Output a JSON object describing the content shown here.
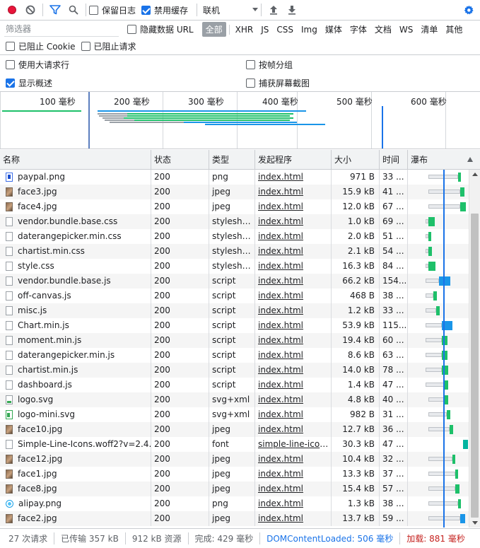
{
  "toolbar": {
    "preserve_log": "保留日志",
    "disable_cache": "禁用缓存",
    "throttle": "联机"
  },
  "filter": {
    "placeholder": "筛选器",
    "hide_data_urls": "隐藏数据 URL",
    "types": [
      "全部",
      "XHR",
      "JS",
      "CSS",
      "Img",
      "媒体",
      "字体",
      "文档",
      "WS",
      "清单",
      "其他"
    ],
    "blocked_cookies": "已阻止 Cookie",
    "blocked_requests": "已阻止请求"
  },
  "settings": {
    "large_rows": "使用大请求行",
    "group_by_frame": "按帧分组",
    "show_overview": "显示概述",
    "capture_screenshots": "捕获屏幕截图"
  },
  "overview": {
    "ticks": [
      "100 毫秒",
      "200 毫秒",
      "300 毫秒",
      "400 毫秒",
      "500 毫秒",
      "600 毫秒"
    ]
  },
  "columns": {
    "name": "名称",
    "status": "状态",
    "type": "类型",
    "initiator": "发起程序",
    "size": "大小",
    "time": "时间",
    "waterfall": "瀑布"
  },
  "requests": [
    {
      "name": "paypal.png",
      "status": "200",
      "type": "png",
      "initiator": "index.html",
      "size": "971 B",
      "time": "33 ...",
      "icon": "blue",
      "wf": {
        "start": 0.1,
        "wait": 0.22,
        "dl": 0.04
      },
      "dl_color": "#1ec06a"
    },
    {
      "name": "face3.jpg",
      "status": "200",
      "type": "jpeg",
      "initiator": "index.html",
      "size": "15.9 kB",
      "time": "41 ...",
      "icon": "img",
      "wf": {
        "start": 0.1,
        "wait": 0.24,
        "dl": 0.05
      },
      "dl_color": "#1ec06a"
    },
    {
      "name": "face4.jpg",
      "status": "200",
      "type": "jpeg",
      "initiator": "index.html",
      "size": "12.0 kB",
      "time": "67 ...",
      "icon": "img",
      "wf": {
        "start": 0.1,
        "wait": 0.24,
        "dl": 0.07
      },
      "dl_color": "#1ec06a"
    },
    {
      "name": "vendor.bundle.base.css",
      "status": "200",
      "type": "stylesheet",
      "initiator": "index.html",
      "size": "1.0 kB",
      "time": "69 ...",
      "icon": "file",
      "wf": {
        "start": 0.08,
        "wait": 0.02,
        "dl": 0.08
      },
      "dl_color": "#1ec06a"
    },
    {
      "name": "daterangepicker.min.css",
      "status": "200",
      "type": "stylesheet",
      "initiator": "index.html",
      "size": "2.0 kB",
      "time": "51 ...",
      "icon": "file",
      "wf": {
        "start": 0.08,
        "wait": 0.02,
        "dl": 0.04
      },
      "dl_color": "#1ec06a"
    },
    {
      "name": "chartist.min.css",
      "status": "200",
      "type": "stylesheet",
      "initiator": "index.html",
      "size": "2.1 kB",
      "time": "54 ...",
      "icon": "file",
      "wf": {
        "start": 0.08,
        "wait": 0.02,
        "dl": 0.05
      },
      "dl_color": "#1ec06a"
    },
    {
      "name": "style.css",
      "status": "200",
      "type": "stylesheet",
      "initiator": "index.html",
      "size": "16.3 kB",
      "time": "84 ...",
      "icon": "file",
      "wf": {
        "start": 0.08,
        "wait": 0.02,
        "dl": 0.09
      },
      "dl_color": "#1ec06a"
    },
    {
      "name": "vendor.bundle.base.js",
      "status": "200",
      "type": "script",
      "initiator": "index.html",
      "size": "66.2 kB",
      "time": "154...",
      "icon": "file",
      "wf": {
        "start": 0.08,
        "wait": 0.1,
        "dl": 0.14
      },
      "dl_color": "#1a95e8"
    },
    {
      "name": "off-canvas.js",
      "status": "200",
      "type": "script",
      "initiator": "index.html",
      "size": "468 B",
      "time": "38 ...",
      "icon": "file",
      "wf": {
        "start": 0.08,
        "wait": 0.06,
        "dl": 0.04
      },
      "dl_color": "#1ec06a"
    },
    {
      "name": "misc.js",
      "status": "200",
      "type": "script",
      "initiator": "index.html",
      "size": "1.2 kB",
      "time": "33 ...",
      "icon": "file",
      "wf": {
        "start": 0.08,
        "wait": 0.08,
        "dl": 0.04
      },
      "dl_color": "#1ec06a"
    },
    {
      "name": "Chart.min.js",
      "status": "200",
      "type": "script",
      "initiator": "index.html",
      "size": "53.9 kB",
      "time": "115...",
      "icon": "file",
      "wf": {
        "start": 0.08,
        "wait": 0.12,
        "dl": 0.14
      },
      "dl_color": "#1a95e8"
    },
    {
      "name": "moment.min.js",
      "status": "200",
      "type": "script",
      "initiator": "index.html",
      "size": "19.4 kB",
      "time": "60 ...",
      "icon": "file",
      "wf": {
        "start": 0.08,
        "wait": 0.12,
        "dl": 0.07
      },
      "dl_color": "#1ec06a"
    },
    {
      "name": "daterangepicker.min.js",
      "status": "200",
      "type": "script",
      "initiator": "index.html",
      "size": "8.6 kB",
      "time": "63 ...",
      "icon": "file",
      "wf": {
        "start": 0.08,
        "wait": 0.12,
        "dl": 0.07
      },
      "dl_color": "#1ec06a"
    },
    {
      "name": "chartist.min.js",
      "status": "200",
      "type": "script",
      "initiator": "index.html",
      "size": "14.0 kB",
      "time": "78 ...",
      "icon": "file",
      "wf": {
        "start": 0.08,
        "wait": 0.12,
        "dl": 0.08
      },
      "dl_color": "#1ec06a"
    },
    {
      "name": "dashboard.js",
      "status": "200",
      "type": "script",
      "initiator": "index.html",
      "size": "1.4 kB",
      "time": "47 ...",
      "icon": "file",
      "wf": {
        "start": 0.08,
        "wait": 0.14,
        "dl": 0.05
      },
      "dl_color": "#1ec06a"
    },
    {
      "name": "logo.svg",
      "status": "200",
      "type": "svg+xml",
      "initiator": "index.html",
      "size": "4.8 kB",
      "time": "40 ...",
      "icon": "svg",
      "wf": {
        "start": 0.1,
        "wait": 0.12,
        "dl": 0.05
      },
      "dl_color": "#1ec06a"
    },
    {
      "name": "logo-mini.svg",
      "status": "200",
      "type": "svg+xml",
      "initiator": "index.html",
      "size": "982 B",
      "time": "31 ...",
      "icon": "svggreen",
      "wf": {
        "start": 0.1,
        "wait": 0.14,
        "dl": 0.04
      },
      "dl_color": "#1ec06a"
    },
    {
      "name": "face10.jpg",
      "status": "200",
      "type": "jpeg",
      "initiator": "index.html",
      "size": "12.7 kB",
      "time": "36 ...",
      "icon": "img",
      "wf": {
        "start": 0.1,
        "wait": 0.16,
        "dl": 0.04
      },
      "dl_color": "#1ec06a"
    },
    {
      "name": "Simple-Line-Icons.woff2?v=2.4.0",
      "status": "200",
      "type": "font",
      "initiator": "simple-line-icon...",
      "size": "30.3 kB",
      "time": "47 ...",
      "icon": "file",
      "wf": {
        "start": 0.36,
        "wait": 0.0,
        "dl": 0.06
      },
      "dl_color": "#00b4a0"
    },
    {
      "name": "face12.jpg",
      "status": "200",
      "type": "jpeg",
      "initiator": "index.html",
      "size": "10.4 kB",
      "time": "32 ...",
      "icon": "img",
      "wf": {
        "start": 0.1,
        "wait": 0.18,
        "dl": 0.04
      },
      "dl_color": "#1ec06a"
    },
    {
      "name": "face1.jpg",
      "status": "200",
      "type": "jpeg",
      "initiator": "index.html",
      "size": "13.3 kB",
      "time": "37 ...",
      "icon": "img",
      "wf": {
        "start": 0.1,
        "wait": 0.2,
        "dl": 0.04
      },
      "dl_color": "#1ec06a"
    },
    {
      "name": "face8.jpg",
      "status": "200",
      "type": "jpeg",
      "initiator": "index.html",
      "size": "15.4 kB",
      "time": "57 ...",
      "icon": "img",
      "wf": {
        "start": 0.1,
        "wait": 0.2,
        "dl": 0.06
      },
      "dl_color": "#1ec06a"
    },
    {
      "name": "alipay.png",
      "status": "200",
      "type": "png",
      "initiator": "index.html",
      "size": "1.3 kB",
      "time": "38 ...",
      "icon": "round",
      "wf": {
        "start": 0.1,
        "wait": 0.22,
        "dl": 0.04
      },
      "dl_color": "#1ec06a"
    },
    {
      "name": "face2.jpg",
      "status": "200",
      "type": "jpeg",
      "initiator": "index.html",
      "size": "13.7 kB",
      "time": "59 ...",
      "icon": "img",
      "wf": {
        "start": 0.1,
        "wait": 0.24,
        "dl": 0.06
      },
      "dl_color": "#1a95e8"
    }
  ],
  "status_bar": {
    "requests": "27 次请求",
    "transferred": "已传输 357 kB",
    "resources": "912 kB 资源",
    "finish": "完成: 429 毫秒",
    "dom_content_loaded": "DOMContentLoaded: 506 毫秒",
    "load": "加载: 881 毫秒"
  },
  "colors": {
    "record": "#e8153a",
    "accent": "#1a73e8",
    "dcl": "#1a73e8",
    "load": "#c5221f"
  }
}
